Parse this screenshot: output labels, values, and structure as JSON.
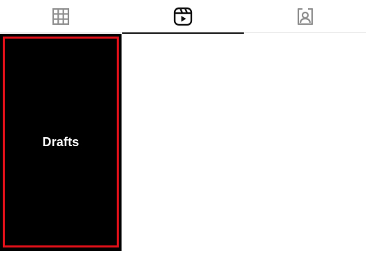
{
  "tabs": [
    {
      "icon": "grid-icon",
      "active": false
    },
    {
      "icon": "reels-icon",
      "active": true
    },
    {
      "icon": "tagged-icon",
      "active": false
    }
  ],
  "grid": {
    "items": [
      {
        "label": "Drafts",
        "highlighted": true
      }
    ]
  },
  "colors": {
    "tile_background": "#000000",
    "highlight": "#e3101a",
    "active_indicator": "#111111",
    "inactive_icon": "#8e8e8e"
  }
}
